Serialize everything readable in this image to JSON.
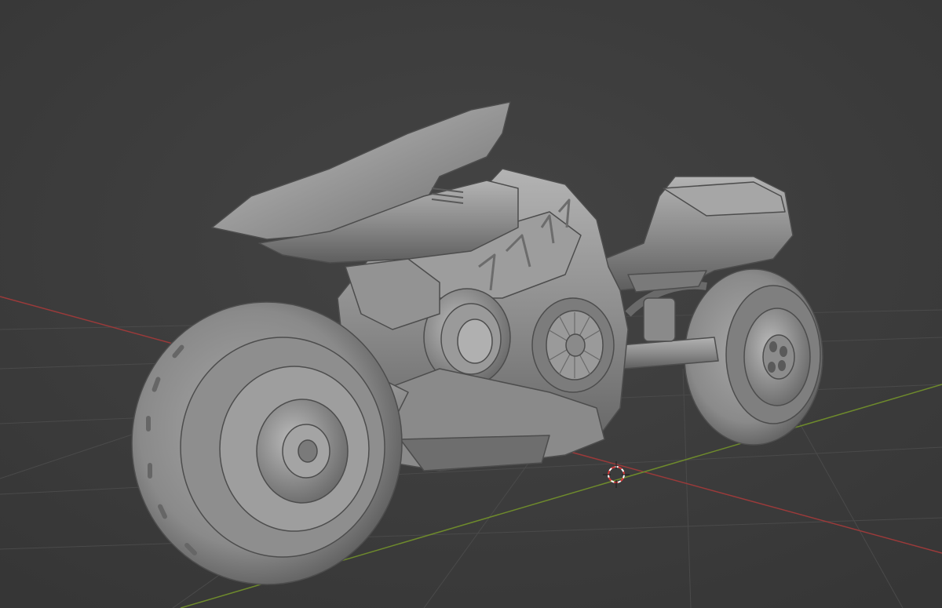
{
  "viewport": {
    "background": "#3d3d3d",
    "view_mode": "solid",
    "axis_x_color": "#9b3a3a",
    "axis_y_color": "#6e8a2c",
    "grid_color": "#4a4a4a"
  },
  "scene": {
    "object": "sci-fi-motorcycle",
    "material_color": "#8f8f8f",
    "decal_text": "JAKE",
    "cursor_icon": "3d-cursor-icon"
  }
}
